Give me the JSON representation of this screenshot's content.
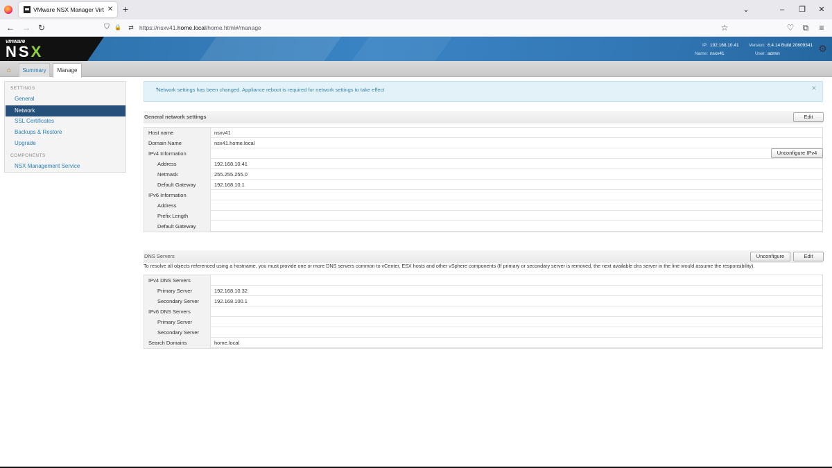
{
  "browser": {
    "tab_title": "VMware NSX Manager Virtual Appliance",
    "tab_close": "✕",
    "new_tab": "+",
    "url_prefix": "https://nsxv41.",
    "url_domain": "home.local",
    "url_suffix": "/home.html#/manage",
    "icons": {
      "back": "←",
      "forward": "→",
      "reload": "↻",
      "shield": "⛉",
      "lock": "🔒",
      "permissions": "⇄",
      "bookmark": "☆",
      "pocket": "♡",
      "extensions": "⧉",
      "menu": "≡",
      "tablist": "⌄",
      "minimize": "–",
      "maximize": "❐",
      "close": "✕"
    }
  },
  "header": {
    "vmware": "vmware",
    "nsx_ns": "NS",
    "nsx_x": "X",
    "ip_label": "IP:",
    "ip_value": "192.168.10.41",
    "name_label": "Name:",
    "name_value": "nsxv41",
    "version_label": "Version:",
    "version_value": "6.4.14 Build 20609341",
    "user_label": "User:",
    "user_value": "admin",
    "gear": "⚙"
  },
  "app_tabs": {
    "home": "⌂",
    "summary": "Summary",
    "manage": "Manage"
  },
  "sidebar": {
    "settings_heading": "SETTINGS",
    "settings_items": [
      "General",
      "Network",
      "SSL Certificates",
      "Backups & Restore",
      "Upgrade"
    ],
    "components_heading": "COMPONENTS",
    "components_items": [
      "NSX Management Service"
    ]
  },
  "alert": {
    "message": "Network settings has been changed. Appliance reboot is required for network settings to take effect",
    "bullet": "•",
    "close": "✕"
  },
  "general": {
    "title": "General network settings",
    "edit_label": "Edit",
    "unconfigure_ipv4_label": "Unconfigure IPv4",
    "rows": [
      {
        "key": "Host name",
        "value": "nsxv41"
      },
      {
        "key": "Domain Name",
        "value": "nsx41.home.local"
      },
      {
        "key": "IPv4 Information",
        "value": ""
      },
      {
        "key": "Address",
        "value": "192.168.10.41"
      },
      {
        "key": "Netmask",
        "value": "255.255.255.0"
      },
      {
        "key": "Default Gateway",
        "value": "192.168.10.1"
      },
      {
        "key": "IPv6 Information",
        "value": ""
      },
      {
        "key": "Address",
        "value": ""
      },
      {
        "key": "Prefix Length",
        "value": ""
      },
      {
        "key": "Default Gateway",
        "value": ""
      }
    ]
  },
  "dns": {
    "title": "DNS Servers",
    "unconfigure_label": "Unconfigure",
    "edit_label": "Edit",
    "description": "To resolve all objects referenced using a hostname, you must provide one or more DNS servers common to vCenter, ESX hosts and other vSphere components (If primary or secondary server is removed, the next available dns server in the line would assume the responsibility).",
    "rows": [
      {
        "key": "IPv4 DNS Servers",
        "value": ""
      },
      {
        "key": "Primary Server",
        "value": "192.168.10.32"
      },
      {
        "key": "Secondary Server",
        "value": "192.168.100.1"
      },
      {
        "key": "IPv6 DNS Servers",
        "value": ""
      },
      {
        "key": "Primary Server",
        "value": ""
      },
      {
        "key": "Secondary Server",
        "value": ""
      },
      {
        "key": "Search Domains",
        "value": "home.local"
      }
    ]
  }
}
